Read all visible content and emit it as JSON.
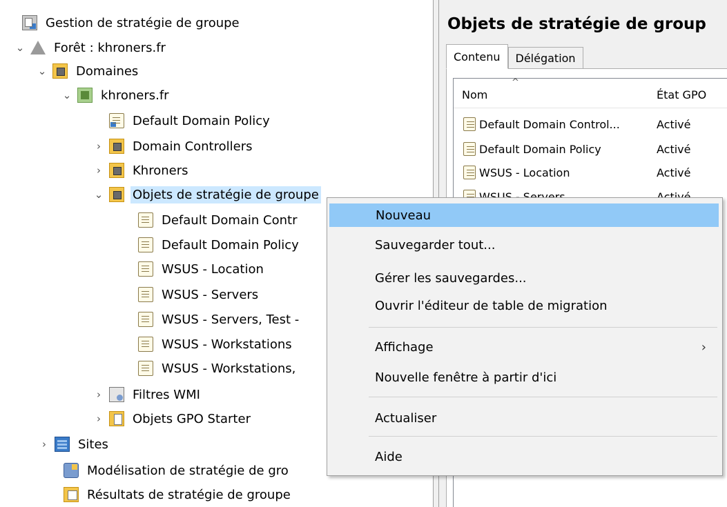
{
  "tree": {
    "items": [
      {
        "label": "Gestion de stratégie de groupe",
        "icon": "gpm-console-icon",
        "expander": ""
      },
      {
        "label": "Forêt : khroners.fr",
        "icon": "forest-icon",
        "expander": "chevron-down"
      },
      {
        "label": "Domaines",
        "icon": "domains-folder-icon",
        "expander": "chevron-down"
      },
      {
        "label": "khroners.fr",
        "icon": "domain-icon",
        "expander": "chevron-down"
      },
      {
        "label": "Default Domain Policy",
        "icon": "gpo-link-icon",
        "expander": ""
      },
      {
        "label": "Domain Controllers",
        "icon": "ou-folder-icon",
        "expander": "chevron-right"
      },
      {
        "label": "Khroners",
        "icon": "ou-folder-icon",
        "expander": "chevron-right"
      },
      {
        "label": "Objets de stratégie de groupe",
        "icon": "gpo-folder-icon",
        "expander": "chevron-down"
      },
      {
        "label": "Default Domain Contr",
        "icon": "gpo-icon",
        "expander": ""
      },
      {
        "label": "Default Domain Policy",
        "icon": "gpo-icon",
        "expander": ""
      },
      {
        "label": "WSUS - Location",
        "icon": "gpo-icon",
        "expander": ""
      },
      {
        "label": "WSUS - Servers",
        "icon": "gpo-icon",
        "expander": ""
      },
      {
        "label": "WSUS - Servers, Test -",
        "icon": "gpo-icon",
        "expander": ""
      },
      {
        "label": "WSUS - Workstations",
        "icon": "gpo-icon",
        "expander": ""
      },
      {
        "label": "WSUS - Workstations,",
        "icon": "gpo-icon",
        "expander": ""
      },
      {
        "label": "Filtres WMI",
        "icon": "wmi-filter-icon",
        "expander": "chevron-right"
      },
      {
        "label": "Objets GPO Starter",
        "icon": "starter-gpo-icon",
        "expander": "chevron-right"
      },
      {
        "label": "Sites",
        "icon": "sites-icon",
        "expander": "chevron-right"
      },
      {
        "label": "Modélisation de stratégie de gro",
        "icon": "modeling-icon",
        "expander": ""
      },
      {
        "label": "Résultats de stratégie de groupe",
        "icon": "results-icon",
        "expander": ""
      }
    ]
  },
  "right": {
    "title": "Objets de stratégie de group",
    "tabs": [
      "Contenu",
      "Délégation"
    ],
    "columns": [
      "Nom",
      "État GPO"
    ],
    "rows": [
      {
        "name": "Default Domain Control...",
        "state": "Activé"
      },
      {
        "name": "Default Domain Policy",
        "state": "Activé"
      },
      {
        "name": "WSUS - Location",
        "state": "Activé"
      },
      {
        "name": "WSUS - Servers",
        "state": "Activé"
      }
    ]
  },
  "menu": {
    "items": [
      {
        "label": "Nouveau"
      },
      {
        "label": "Sauvegarder tout..."
      },
      {
        "label": "Gérer les sauvegardes..."
      },
      {
        "label": "Ouvrir l'éditeur de table de migration"
      },
      {
        "label": "Affichage",
        "submenu": "›"
      },
      {
        "label": "Nouvelle fenêtre à partir d'ici"
      },
      {
        "label": "Actualiser"
      },
      {
        "label": "Aide"
      }
    ]
  },
  "colors": {
    "selection": "#cce8ff",
    "menu_highlight": "#91c9f7"
  }
}
